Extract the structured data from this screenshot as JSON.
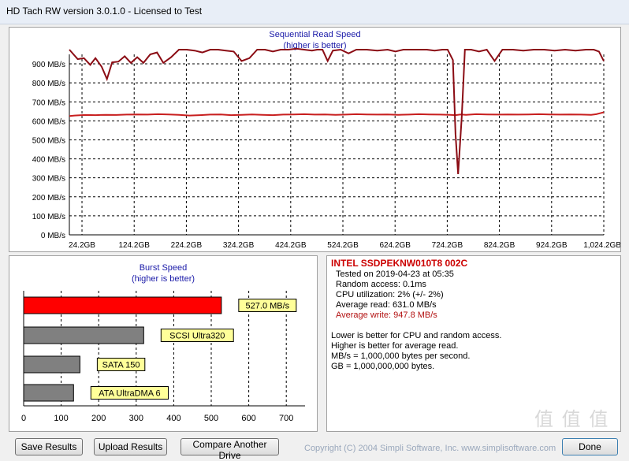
{
  "window": {
    "title": "HD Tach RW version 3.0.1.0 - Licensed to Test"
  },
  "sequential": {
    "title": "Sequential Read Speed",
    "subtitle": "(higher is better)"
  },
  "burst": {
    "title": "Burst Speed",
    "subtitle": "(higher is better)"
  },
  "info": {
    "drive_name": "INTEL SSDPEKNW010T8 002C",
    "tested_on": "Tested on 2019-04-23 at 05:35",
    "random_access": "Random access: 0.1ms",
    "cpu_util": "CPU utilization: 2% (+/- 2%)",
    "avg_read": "Average read: 631.0 MB/s",
    "avg_write": "Average write: 947.8 MB/s",
    "note1": "Lower is better for CPU and random access.",
    "note2": "Higher is better for average read.",
    "note3": "MB/s = 1,000,000 bytes per second.",
    "note4": "GB = 1,000,000,000 bytes."
  },
  "buttons": {
    "save": "Save Results",
    "upload": "Upload Results",
    "compare": "Compare Another Drive",
    "done": "Done"
  },
  "footer": {
    "copyright": "Copyright (C) 2004 Simpli Software, Inc. www.simplisoftware.com"
  },
  "watermark": "值 值 值",
  "colors": {
    "read_line": "#c81f1f",
    "write_line": "#8b0c14",
    "drive_bar": "#ff0000",
    "compare_bar": "#808080",
    "label_bg": "#ffff99",
    "title_blue": "#1a1aa8"
  },
  "chart_data": [
    {
      "type": "line",
      "title": "Sequential Read Speed",
      "subtitle": "(higher is better)",
      "ylabel": "",
      "xlabel": "",
      "ylim": [
        0,
        950
      ],
      "xlim": [
        0,
        1024.2
      ],
      "yticks": [
        0,
        100,
        200,
        300,
        400,
        500,
        600,
        700,
        800,
        900
      ],
      "ytick_labels": [
        "0 MB/s",
        "100 MB/s",
        "200 MB/s",
        "300 MB/s",
        "400 MB/s",
        "500 MB/s",
        "600 MB/s",
        "700 MB/s",
        "800 MB/s",
        "900 MB/s"
      ],
      "xticks": [
        24.2,
        124.2,
        224.2,
        324.2,
        424.2,
        524.2,
        624.2,
        724.2,
        824.2,
        924.2,
        1024.2
      ],
      "xtick_labels": [
        "24.2GB",
        "124.2GB",
        "224.2GB",
        "324.2GB",
        "424.2GB",
        "524.2GB",
        "624.2GB",
        "724.2GB",
        "824.2GB",
        "924.2GB",
        "1,024.2GB"
      ],
      "grid": true,
      "series": [
        {
          "color": "#c81f1f",
          "x": [
            0,
            10,
            30,
            50,
            70,
            90,
            110,
            130,
            150,
            170,
            190,
            210,
            230,
            250,
            270,
            290,
            310,
            330,
            350,
            370,
            390,
            410,
            430,
            450,
            470,
            490,
            510,
            530,
            550,
            570,
            590,
            610,
            630,
            650,
            670,
            690,
            710,
            730,
            740,
            750,
            760,
            780,
            800,
            820,
            840,
            860,
            880,
            900,
            920,
            940,
            960,
            980,
            1000,
            1010,
            1024.2
          ],
          "y": [
            625,
            628,
            631,
            630,
            632,
            631,
            633,
            634,
            633,
            635,
            634,
            632,
            628,
            630,
            633,
            634,
            630,
            632,
            634,
            632,
            630,
            633,
            634,
            635,
            633,
            634,
            632,
            633,
            635,
            634,
            633,
            634,
            632,
            633,
            635,
            634,
            633,
            632,
            630,
            634,
            632,
            635,
            634,
            633,
            634,
            633,
            634,
            635,
            634,
            633,
            634,
            633,
            632,
            635,
            645
          ]
        },
        {
          "color": "#8b0c14",
          "x": [
            0,
            8,
            16,
            28,
            40,
            50,
            62,
            72,
            82,
            94,
            106,
            118,
            130,
            142,
            155,
            168,
            180,
            195,
            210,
            225,
            240,
            255,
            270,
            285,
            300,
            315,
            330,
            345,
            360,
            375,
            390,
            405,
            420,
            435,
            450,
            465,
            475,
            485,
            495,
            505,
            520,
            535,
            550,
            570,
            590,
            610,
            625,
            640,
            655,
            670,
            685,
            700,
            715,
            725,
            735,
            740,
            745,
            752,
            758,
            770,
            785,
            800,
            815,
            830,
            850,
            870,
            890,
            910,
            930,
            950,
            970,
            990,
            1005,
            1015,
            1024.2
          ],
          "y": [
            975,
            950,
            925,
            930,
            895,
            930,
            885,
            820,
            908,
            912,
            940,
            905,
            935,
            905,
            950,
            960,
            905,
            935,
            975,
            975,
            970,
            960,
            975,
            975,
            970,
            965,
            915,
            930,
            975,
            975,
            965,
            975,
            975,
            980,
            975,
            970,
            975,
            975,
            915,
            970,
            975,
            955,
            975,
            975,
            970,
            975,
            965,
            975,
            975,
            975,
            975,
            970,
            975,
            975,
            920,
            530,
            320,
            620,
            975,
            975,
            965,
            975,
            915,
            975,
            975,
            970,
            975,
            975,
            970,
            975,
            970,
            975,
            975,
            965,
            915
          ]
        }
      ]
    },
    {
      "type": "bar",
      "title": "Burst Speed",
      "subtitle": "(higher is better)",
      "orientation": "horizontal",
      "xlim": [
        0,
        750
      ],
      "xticks": [
        0,
        100,
        200,
        300,
        400,
        500,
        600,
        700
      ],
      "xtick_labels": [
        "0",
        "100",
        "200",
        "300",
        "400",
        "500",
        "600",
        "700"
      ],
      "categories": [
        "527.0 MB/s",
        "SCSI Ultra320",
        "SATA 150",
        "ATA UltraDMA 6"
      ],
      "values": [
        527.0,
        320,
        150,
        133
      ],
      "colors": [
        "#ff0000",
        "#808080",
        "#808080",
        "#808080"
      ],
      "grid": true
    }
  ]
}
